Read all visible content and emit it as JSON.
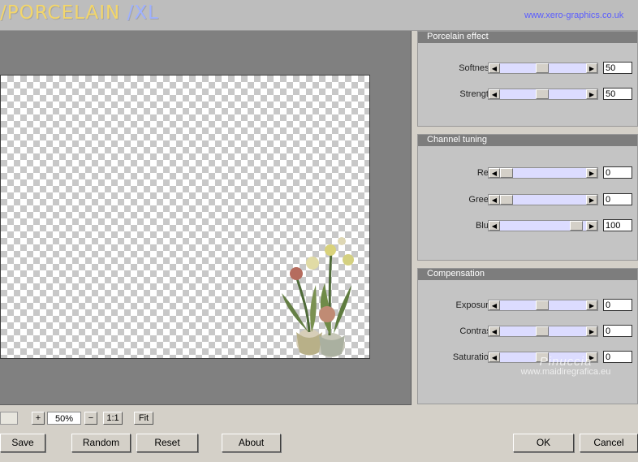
{
  "app": {
    "logo": {
      "text": "/PORCELAIN",
      "suffix": "/XL"
    },
    "site_link": "www.xero-graphics.co.uk"
  },
  "panels": {
    "porcelain_effect": {
      "title": "Porcelain effect",
      "rows": [
        {
          "label": "Softness",
          "value": "50",
          "level": 0.5
        },
        {
          "label": "Strength",
          "value": "50",
          "level": 0.5
        }
      ]
    },
    "channel_tuning": {
      "title": "Channel tuning",
      "rows": [
        {
          "label": "Red",
          "value": "0",
          "level": 0
        },
        {
          "label": "Green",
          "value": "0",
          "level": 0
        },
        {
          "label": "Blue",
          "value": "100",
          "level": 1
        }
      ]
    },
    "compensation": {
      "title": "Compensation",
      "rows": [
        {
          "label": "Exposure",
          "value": "0",
          "level": 0.5
        },
        {
          "label": "Contrast",
          "value": "0",
          "level": 0.5
        },
        {
          "label": "Saturation",
          "value": "0",
          "level": 0.5
        }
      ]
    }
  },
  "zoom": {
    "plus": "+",
    "value": "50%",
    "minus": "−",
    "actual": "1:1",
    "fit": "Fit"
  },
  "buttons": {
    "save": "Save",
    "random": "Random",
    "reset": "Reset",
    "about": "About",
    "ok": "OK",
    "cancel": "Cancel"
  },
  "watermark": {
    "name": "Pinuccia",
    "site": "www.maidiregrafica.eu"
  },
  "colors": {
    "slider_track": "#dcdcff",
    "panel_title_bg": "#7d7d7d",
    "link": "#5a5cff"
  }
}
